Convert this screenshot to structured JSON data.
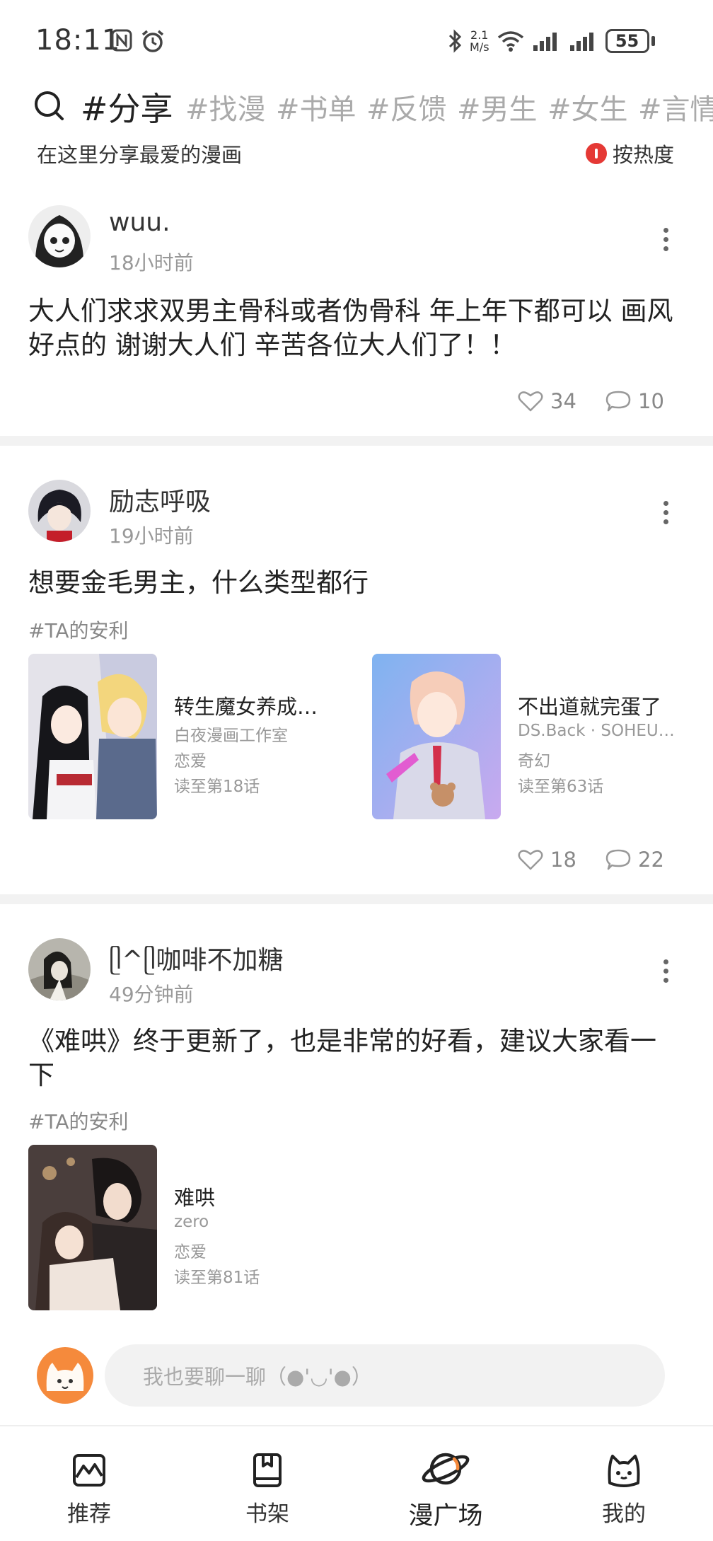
{
  "status_bar": {
    "time": "18:11",
    "net_speed_top": "2.1",
    "net_speed_bottom": "M/s",
    "battery": "55"
  },
  "tags": [
    {
      "label": "#分享",
      "active": true
    },
    {
      "label": "#找漫"
    },
    {
      "label": "#书单"
    },
    {
      "label": "#反馈"
    },
    {
      "label": "#男生"
    },
    {
      "label": "#女生"
    },
    {
      "label": "#言情"
    }
  ],
  "subheader": {
    "caption": "在这里分享最爱的漫画",
    "sort_label": "按热度"
  },
  "posts": [
    {
      "username": "wuu.",
      "time": "18小时前",
      "text": "大人们求求双男主骨科或者伪骨科 年上年下都可以 画风好点的 谢谢大人们 辛苦各位大人们了！！",
      "likes": "34",
      "comments": "10"
    },
    {
      "username": "励志呼吸",
      "time": "19小时前",
      "text": "想要金毛男主，什么类型都行",
      "hashtag": "#TA的安利",
      "comics": [
        {
          "title": "转生魔女养成了...",
          "author": "白夜漫画工作室",
          "genre": "恋爱",
          "progress": "读至第18话"
        },
        {
          "title": "不出道就完蛋了",
          "author": "DS.Back · SOHEUN · .",
          "genre": "奇幻",
          "progress": "读至第63话"
        }
      ],
      "likes": "18",
      "comments": "22"
    },
    {
      "username": "ᥫ^ᥫ咖啡不加糖",
      "time": "49分钟前",
      "text": "《难哄》终于更新了，也是非常的好看，建议大家看一下",
      "hashtag": "#TA的安利",
      "comics": [
        {
          "title": "难哄",
          "author": "zero",
          "genre": "恋爱",
          "progress": "读至第81话"
        }
      ]
    }
  ],
  "chat_input": {
    "placeholder": "我也要聊一聊（●'◡'●）"
  },
  "bottom_nav": [
    {
      "label": "推荐",
      "icon": "recommend-icon"
    },
    {
      "label": "书架",
      "icon": "bookshelf-icon"
    },
    {
      "label": "漫广场",
      "icon": "planet-icon",
      "active": true
    },
    {
      "label": "我的",
      "icon": "cat-face-icon"
    }
  ]
}
